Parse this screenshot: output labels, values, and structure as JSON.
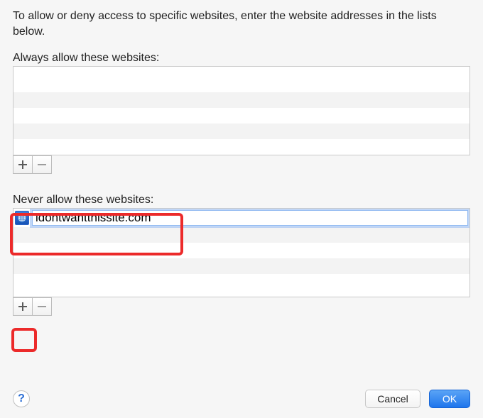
{
  "instructions": "To allow or deny access to specific websites, enter the website addresses in the lists below.",
  "allow": {
    "label": "Always allow these websites:",
    "items": []
  },
  "never": {
    "label": "Never allow these websites:",
    "editing_value": "idontwantthissite.com",
    "items": []
  },
  "buttons": {
    "add_tooltip": "Add",
    "remove_tooltip": "Remove",
    "cancel": "Cancel",
    "ok": "OK",
    "help_tooltip": "Help"
  },
  "icons": {
    "globe": "globe-icon",
    "plus": "plus-icon",
    "minus": "minus-icon",
    "help": "help-icon"
  }
}
